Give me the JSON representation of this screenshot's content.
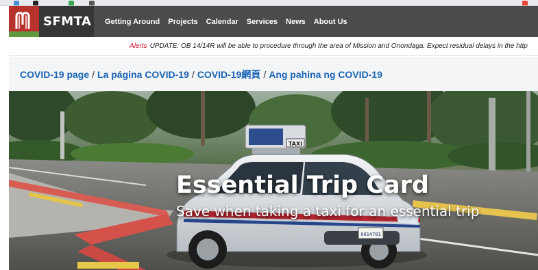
{
  "site": {
    "brand_name": "SFMTA",
    "logo_icon": "sfmta-muni-logo",
    "colors": {
      "logo_red": "#b8322c",
      "logo_green": "#5f9a3d",
      "nav_bg": "#4b4b4b",
      "link_blue": "#1b64b4",
      "alert_red": "#c8102e"
    }
  },
  "nav": {
    "items": [
      {
        "label": "Getting Around"
      },
      {
        "label": "Projects"
      },
      {
        "label": "Calendar"
      },
      {
        "label": "Services"
      },
      {
        "label": "News"
      },
      {
        "label": "About Us"
      }
    ]
  },
  "alert": {
    "label": "Alerts",
    "text": "UPDATE: OB 14/14R will be able to procedure through the area of Mission and Onondaga. Expect residual delays in the http"
  },
  "covid_links": [
    {
      "label": "COVID-19 page"
    },
    {
      "label": "La página COVID-19"
    },
    {
      "label": "COVID-19網頁"
    },
    {
      "label": "Ang pahina ng COVID-19"
    }
  ],
  "hero": {
    "title": "Essential Trip Card",
    "subtitle": "Save when taking a taxi for an essential trip",
    "taxi_roof_sign": "TAXI",
    "license_plate": "0014701"
  }
}
